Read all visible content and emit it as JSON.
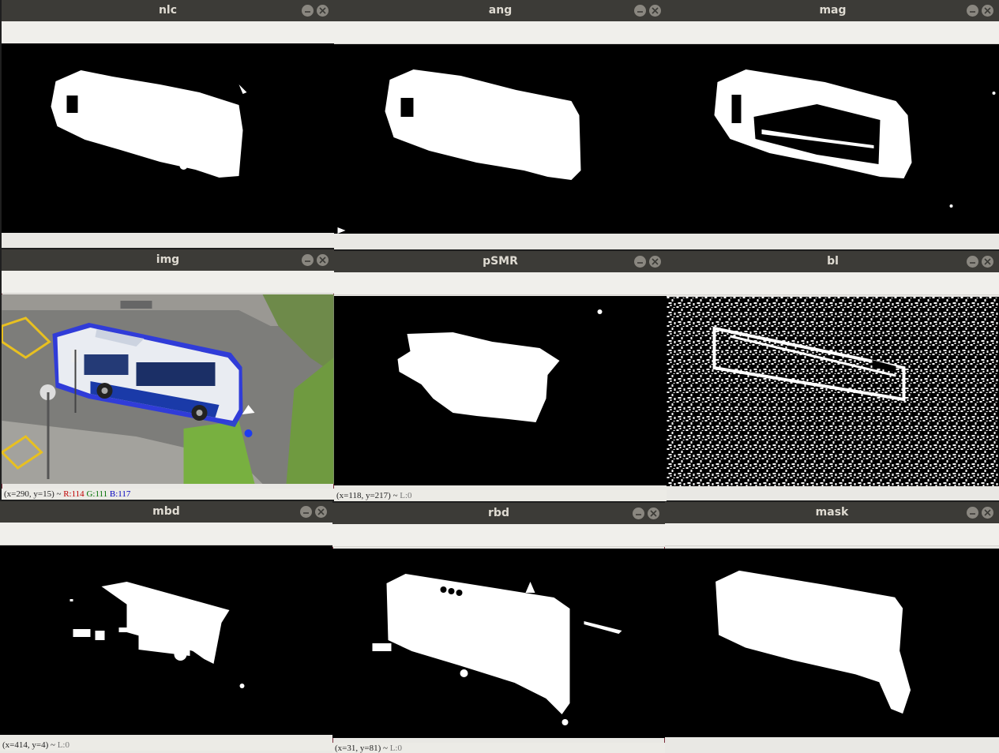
{
  "windows": {
    "nlc": {
      "title": "nlc"
    },
    "ang": {
      "title": "ang"
    },
    "mag": {
      "title": "mag"
    },
    "img": {
      "title": "img",
      "status": {
        "coord": "(x=290, y=15) ~",
        "r": "R:114",
        "g": "G:111",
        "b": "B:117"
      }
    },
    "pSMR": {
      "title": "pSMR",
      "status": {
        "coord": "(x=118, y=217) ~",
        "l": "L:0"
      }
    },
    "bl": {
      "title": "bl"
    },
    "mbd": {
      "title": "mbd",
      "status": {
        "coord": "(x=414, y=4) ~",
        "l": "L:0"
      }
    },
    "rbd": {
      "title": "rbd",
      "status": {
        "coord": "(x=31, y=81) ~",
        "l": "L:0"
      }
    },
    "mask": {
      "title": "mask"
    }
  },
  "icons": {
    "minimize": "minimize-icon",
    "close": "close-icon"
  },
  "colors": {
    "titlebar": "#3c3b37",
    "title_text": "#dfdbd2",
    "active_border": "#7a2b3a",
    "highlight_blue": "#1d2cf0"
  }
}
